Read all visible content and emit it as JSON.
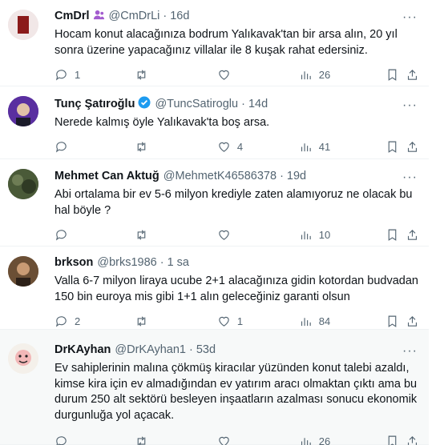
{
  "tweets": [
    {
      "name": "CmDrl",
      "handle": "@CmDrLi",
      "dot": "·",
      "time": "16d",
      "badge": "user-group-icon",
      "text": "Hocam konut alacağınıza bodrum Yalıkavak'tan bir arsa alın, 20 yıl sonra üzerine yapacağınız villalar ile 8 kuşak rahat edersiniz.",
      "replies": "1",
      "retweets": "",
      "likes": "",
      "views": "26"
    },
    {
      "name": "Tunç Şatıroğlu",
      "handle": "@TuncSatiroglu",
      "dot": "·",
      "time": "14d",
      "badge": "verified-icon",
      "text": "Nerede kalmış öyle Yalıkavak'ta boş arsa.",
      "replies": "",
      "retweets": "",
      "likes": "4",
      "views": "41"
    },
    {
      "name": "Mehmet Can Aktuğ",
      "handle": "@MehmetK46586378",
      "dot": "·",
      "time": "19d",
      "badge": "",
      "text": "Abi ortalama bir ev 5-6 milyon krediyle zaten alamıyoruz ne olacak bu hal böyle ?",
      "replies": "",
      "retweets": "",
      "likes": "",
      "views": "10"
    },
    {
      "name": "brkson",
      "handle": "@brks1986",
      "dot": "·",
      "time": "1 sa",
      "badge": "",
      "text": "Valla 6-7 milyon liraya ucube 2+1 alacağınıza gidin kotordan budvadan 150 bin euroya mis gibi 1+1 alın geleceğiniz garanti olsun",
      "replies": "2",
      "retweets": "",
      "likes": "1",
      "views": "84"
    },
    {
      "name": "DrKAyhan",
      "handle": "@DrKAyhan1",
      "dot": "·",
      "time": "53d",
      "badge": "",
      "text": "Ev sahiplerinin malına çökmüş kiracılar yüzünden konut talebi azaldı, kimse kira için ev almadığından ev yatırım aracı olmaktan çıktı ama bu durum 250 alt sektörü besleyen inşaatların azalması sonucu ekonomik durgunluğa yol açacak.",
      "replies": "",
      "retweets": "",
      "likes": "",
      "views": "26"
    }
  ],
  "more_label": "···",
  "colors": {
    "verified": "#1d9bf0",
    "affiliate": "#a35ccf",
    "muted": "#536471"
  },
  "icons": [
    "reply-icon",
    "retweet-icon",
    "like-icon",
    "views-icon",
    "bookmark-icon",
    "share-icon"
  ]
}
